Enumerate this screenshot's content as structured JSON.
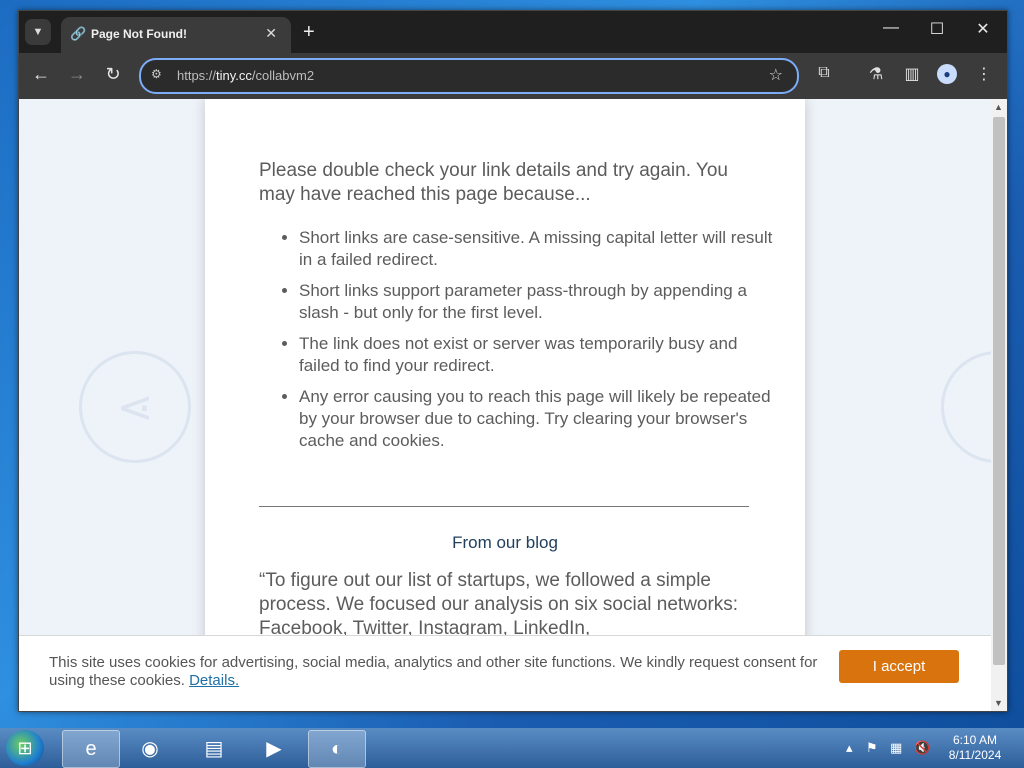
{
  "browser": {
    "tab": {
      "title": "Page Not Found!"
    },
    "url_prefix": "https://",
    "url_host": "tiny.cc",
    "url_path": "/collabvm2"
  },
  "page": {
    "lead": "Please double check your link details and try again. You may have reached this page because...",
    "reasons": [
      "Short links are case-sensitive. A missing capital letter will result in a failed redirect.",
      "Short links support parameter pass-through by appending a slash - but only for the first level.",
      "The link does not exist or server was temporarily busy and failed to find your redirect.",
      "Any error causing you to reach this page will likely be repeated by your browser due to caching. Try clearing your browser's cache and cookies."
    ],
    "blog_heading": "From our blog",
    "blog_quote": "“To figure out our list of startups, we followed a simple process. We focused our analysis on six social networks: Facebook, Twitter, Instagram, LinkedIn,"
  },
  "cookie_banner": {
    "message": "This site uses cookies for advertising, social media, analytics and other site functions. We kindly request consent for using these cookies.",
    "details_link": "Details.",
    "accept_label": "I accept"
  },
  "taskbar": {
    "time": "6:10 AM",
    "date": "8/11/2024"
  },
  "colors": {
    "accept_button": "#d9730d",
    "omnibox_focus": "#7cacf8",
    "blog_heading": "#22405e"
  }
}
